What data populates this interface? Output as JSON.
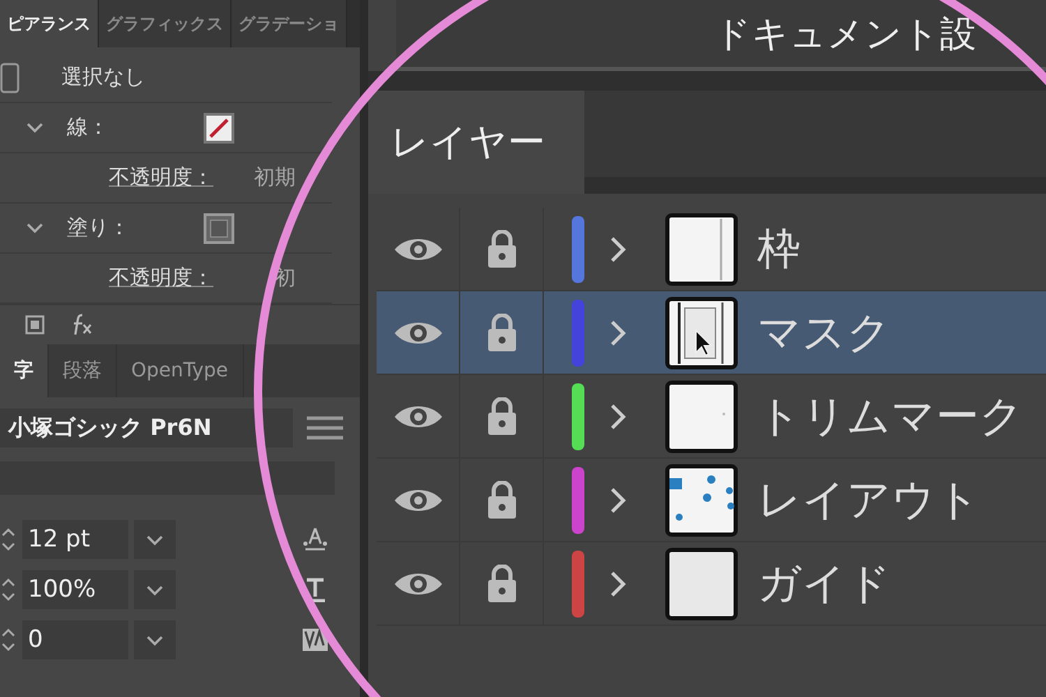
{
  "appearance_panel": {
    "tabs": [
      {
        "label": "ピアランス",
        "selected": true
      },
      {
        "label": "グラフィックス",
        "selected": false
      },
      {
        "label": "グラデーショ",
        "selected": false
      }
    ],
    "selection": "選択なし",
    "properties": [
      {
        "kind": "stroke",
        "label": "線：",
        "expanded": true,
        "opacity_label": "不透明度：",
        "opacity_value": "初期"
      },
      {
        "kind": "fill",
        "label": "塗り：",
        "expanded": true,
        "opacity_label": "不透明度：",
        "opacity_value": "初"
      }
    ]
  },
  "character_panel": {
    "tabs": [
      {
        "label": "字",
        "selected": true
      },
      {
        "label": "段落",
        "selected": false
      },
      {
        "label": "OpenType",
        "selected": false
      }
    ],
    "font": "小塚ゴシック Pr6N",
    "fields": [
      {
        "kind": "size",
        "value": "12 pt"
      },
      {
        "kind": "scale",
        "value": "100%"
      },
      {
        "kind": "tracking",
        "value": "0"
      }
    ]
  },
  "document_title": "ドキュメント設",
  "layers_panel": {
    "tab": "レイヤー",
    "layers": [
      {
        "name": "枠",
        "color": "#5577dd",
        "visible": true,
        "locked": true,
        "selected": false
      },
      {
        "name": "マスク",
        "color": "#4444dd",
        "visible": true,
        "locked": true,
        "selected": true
      },
      {
        "name": "トリムマーク",
        "color": "#55dd55",
        "visible": true,
        "locked": true,
        "selected": false
      },
      {
        "name": "レイアウト",
        "color": "#cc44cc",
        "visible": true,
        "locked": true,
        "selected": false
      },
      {
        "name": "ガイド",
        "color": "#cc4444",
        "visible": true,
        "locked": true,
        "selected": false
      }
    ]
  }
}
